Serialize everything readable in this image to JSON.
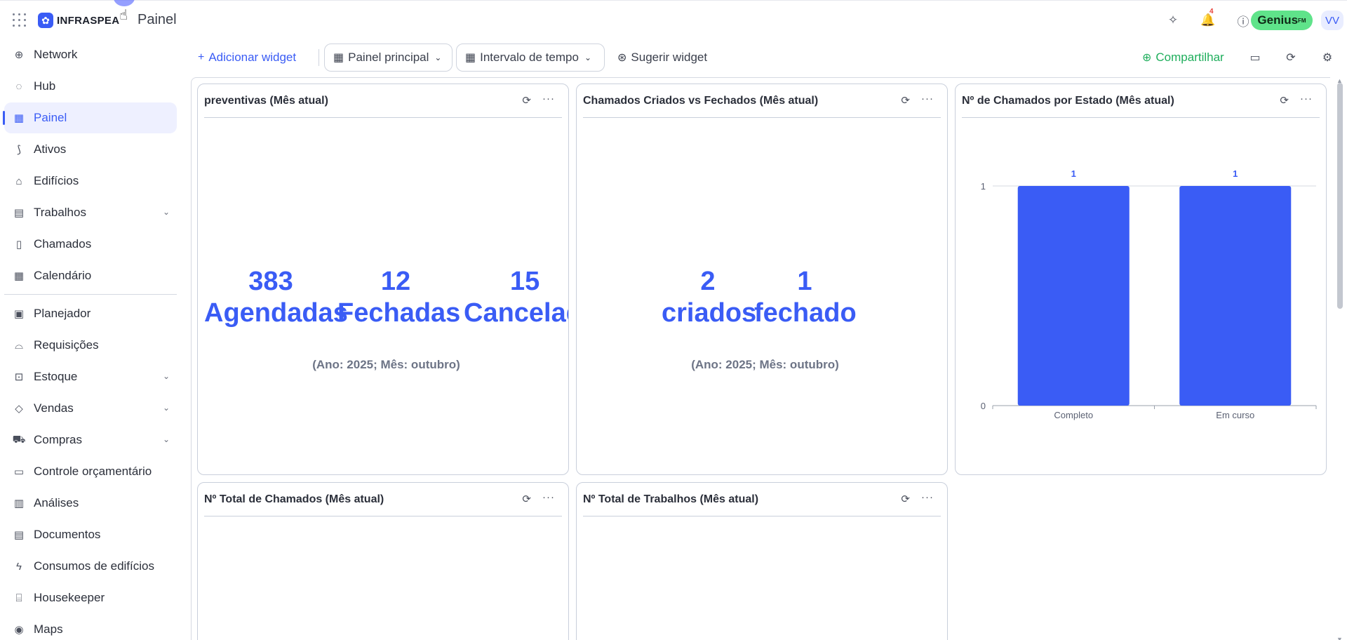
{
  "app": {
    "logo_mark": "✿",
    "logo_text": "INFRASPEA",
    "page_title": "Painel",
    "notifications_count": "4",
    "genius_label": "Genius",
    "genius_sup": "FM",
    "avatar_initials": "VV"
  },
  "sidebar": {
    "items": [
      {
        "label": "Network",
        "icon": "network-icon",
        "glyph": "⊕"
      },
      {
        "label": "Hub",
        "icon": "hub-icon",
        "glyph": "◌"
      },
      {
        "label": "Painel",
        "icon": "dashboard-icon",
        "glyph": "▦"
      },
      {
        "label": "Ativos",
        "icon": "assets-icon",
        "glyph": "⟆"
      },
      {
        "label": "Edifícios",
        "icon": "building-icon",
        "glyph": "⌂"
      },
      {
        "label": "Trabalhos",
        "icon": "calendar-work-icon",
        "glyph": "▤"
      },
      {
        "label": "Chamados",
        "icon": "ticket-icon",
        "glyph": "▯"
      },
      {
        "label": "Calendário",
        "icon": "calendar-icon",
        "glyph": "▦"
      },
      {
        "label": "Planejador",
        "icon": "planner-icon",
        "glyph": "▣"
      },
      {
        "label": "Requisições",
        "icon": "service-bell-icon",
        "glyph": "⌓"
      },
      {
        "label": "Estoque",
        "icon": "inventory-icon",
        "glyph": "⊡"
      },
      {
        "label": "Vendas",
        "icon": "tag-icon",
        "glyph": "◇"
      },
      {
        "label": "Compras",
        "icon": "cart-icon",
        "glyph": "⛟"
      },
      {
        "label": "Controle orçamentário",
        "icon": "wallet-icon",
        "glyph": "▭"
      },
      {
        "label": "Análises",
        "icon": "bar-chart-icon",
        "glyph": "▥"
      },
      {
        "label": "Documentos",
        "icon": "document-icon",
        "glyph": "▤"
      },
      {
        "label": "Consumos de edifícios",
        "icon": "lightning-icon",
        "glyph": "ϟ"
      },
      {
        "label": "Housekeeper",
        "icon": "bed-icon",
        "glyph": "⌸"
      },
      {
        "label": "Maps",
        "icon": "map-pin-icon",
        "glyph": "◉"
      }
    ]
  },
  "toolbar": {
    "add_widget": "Adicionar widget",
    "dashboard_select": "Painel principal",
    "time_interval": "Intervalo de tempo",
    "suggest_widget": "Sugerir widget",
    "share": "Compartilhar"
  },
  "widgets": {
    "preventivas": {
      "title": "preventivas (Mês atual)",
      "kpis": [
        {
          "value": "383",
          "label": "Agendadas"
        },
        {
          "value": "12",
          "label": "Fechadas"
        },
        {
          "value": "15",
          "label": "Cancelad"
        }
      ],
      "subtitle": "(Ano: 2025; Mês: outubro)"
    },
    "chamados_criados": {
      "title": "Chamados Criados vs Fechados (Mês atual)",
      "kpis": [
        {
          "value": "2",
          "label": "criados"
        },
        {
          "value": "1",
          "label": "fechado"
        }
      ],
      "subtitle": "(Ano: 2025; Mês: outubro)"
    },
    "chamados_estado": {
      "title": "Nº de Chamados por Estado (Mês atual)"
    },
    "total_chamados": {
      "title": "Nº Total de Chamados (Mês atual)"
    },
    "total_trabalhos": {
      "title": "Nº Total de Trabalhos (Mês atual)"
    }
  },
  "chart_data": {
    "type": "bar",
    "categories": [
      "Completo",
      "Em curso"
    ],
    "values": [
      1,
      1
    ],
    "data_labels": [
      "1",
      "1"
    ],
    "yticks": [
      "0",
      "1"
    ],
    "ylim": [
      0,
      1
    ],
    "color": "#3a5cf5",
    "grid": true
  }
}
